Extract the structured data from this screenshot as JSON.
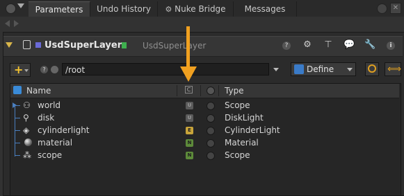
{
  "tabs": [
    {
      "label": "Parameters",
      "active": true
    },
    {
      "label": "Undo History"
    },
    {
      "label": "Nuke Bridge"
    },
    {
      "label": "Messages"
    }
  ],
  "node": {
    "type_label": "UsdSuperLayer",
    "name": "UsdSuperLayer"
  },
  "toolbar": {
    "add_label": "+",
    "path_value": "/root",
    "mode_value": "Define"
  },
  "table": {
    "headers": {
      "name": "Name",
      "c": "C",
      "type": "Type"
    },
    "rows": [
      {
        "name": "world",
        "badge": "U",
        "type": "Scope",
        "icon": "world-icon"
      },
      {
        "name": "disk",
        "badge": "U",
        "type": "DiskLight",
        "icon": "disk-light-icon"
      },
      {
        "name": "cylinderlight",
        "badge": "E",
        "type": "CylinderLight",
        "icon": "cylinder-light-icon"
      },
      {
        "name": "material",
        "badge": "N",
        "type": "Material",
        "icon": "material-icon"
      },
      {
        "name": "scope",
        "badge": "N",
        "type": "Scope",
        "icon": "scope-icon"
      }
    ]
  },
  "colors": {
    "arrow": "#f0a020",
    "badge_u": "#5a5a5a",
    "badge_e": "#c8a43a",
    "badge_n": "#5d8a3a",
    "tree": "#4a7fbf",
    "node_color_swatch": "#6a6ad8",
    "node_green_swatch": "#3fb04f"
  }
}
